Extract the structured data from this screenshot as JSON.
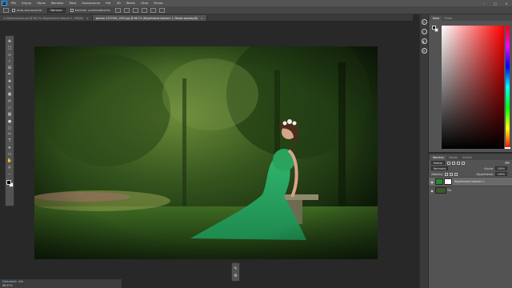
{
  "menubar": {
    "logo": "Ps",
    "items": [
      "Plik",
      "Edycja",
      "Obraz",
      "Warstwa",
      "Tekst",
      "Zaznaczanie",
      "Filtr",
      "3D",
      "Widok",
      "Okno",
      "Pomoc"
    ]
  },
  "options": {
    "auto_select_label": "Auto-zaznaczanie:",
    "auto_select_value": "Warstwa",
    "transform_label": "Kontroln. przekształcenia"
  },
  "tabs": [
    {
      "label": "1c-Metamorfoza.psd @ 66,7% (Wypełnienie kolorem 1, RGB/8)",
      "active": false
    },
    {
      "label": "woman-3127061_1920.jpg @ 66,7% (Wypełnienie kolorem 1, Maska warstwy/8)",
      "active": true
    }
  ],
  "tools": [
    "move",
    "marquee",
    "lasso",
    "quick-select",
    "crop",
    "eyedropper",
    "healing",
    "brush",
    "stamp",
    "history-brush",
    "eraser",
    "gradient",
    "blur",
    "dodge",
    "pen",
    "type",
    "path-select",
    "shape",
    "hand",
    "zoom",
    "ellipsis"
  ],
  "colors": {
    "foreground": "#000000",
    "background": "#ffffff",
    "accent": "#31a8ff"
  },
  "status": {
    "title": "Dokument: Info",
    "line": "66,67%"
  },
  "color_panel": {
    "tabs": [
      "Kolor",
      "Próbki"
    ],
    "hue_marker": 0.99
  },
  "layers_panel": {
    "tabs": [
      "Warstwy",
      "Kanały",
      "Ścieżki"
    ],
    "filter_label": "Rodzaj",
    "blend_mode": "Normalny",
    "opacity_label": "Krycie:",
    "opacity_value": "100%",
    "lock_label": "Zablokuj:",
    "fill_label": "Wypełnienie:",
    "fill_value": "100%",
    "layers": [
      {
        "name": "Wypełnienie kolorem 1",
        "selected": true,
        "thumb_color": "#2a8a3a"
      },
      {
        "name": "Tło",
        "selected": false,
        "thumb_color": "#3d5a2a"
      }
    ]
  }
}
